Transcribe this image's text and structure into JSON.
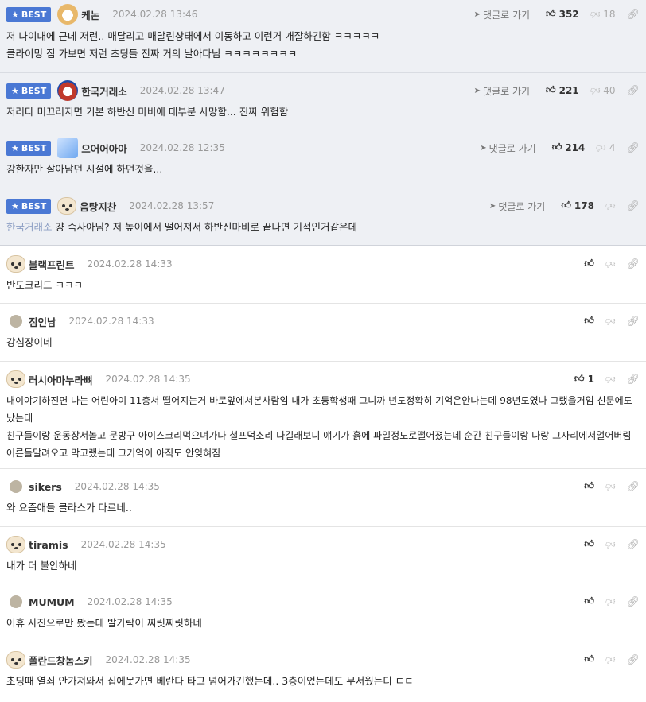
{
  "labels": {
    "best": "BEST",
    "goto": "댓글로 가기"
  },
  "comments": [
    {
      "nick": "케논",
      "date": "2024.02.28 13:46",
      "up": "352",
      "down": "18",
      "lines": [
        "저 나이대에 근데 저런.. 매달리고 매달린상태에서 이동하고 이런거 개잘하긴함 ㅋㅋㅋㅋㅋ",
        "클라이밍 짐 가보면 저런 초딩들 진짜 거의 날아다님 ㅋㅋㅋㅋㅋㅋㅋㅋ"
      ]
    },
    {
      "nick": "한국거래소",
      "date": "2024.02.28 13:47",
      "up": "221",
      "down": "40",
      "lines": [
        "저러다 미끄러지면 기본 하반신 마비에 대부분 사망함... 진짜 위험함"
      ]
    },
    {
      "nick": "으어어아아",
      "date": "2024.02.28 12:35",
      "up": "214",
      "down": "4",
      "lines": [
        "강한자만 살아남던 시절에 하던것을..."
      ]
    },
    {
      "nick": "음탕지찬",
      "date": "2024.02.28 13:57",
      "up": "178",
      "quote": "한국거래소",
      "lines": [
        "걍 즉사아님? 저 높이에서 떨어져서 하반신마비로 끝나면 기적인거같은데"
      ]
    },
    {
      "nick": "블랙프린트",
      "date": "2024.02.28 14:33",
      "lines": [
        "반도크리드 ㅋㅋㅋ"
      ]
    },
    {
      "nick": "짐인남",
      "date": "2024.02.28 14:33",
      "lines": [
        "강심장이네"
      ]
    },
    {
      "nick": "러시아마누라뼈",
      "date": "2024.02.28 14:35",
      "up": "1",
      "lines": [
        "내이야기하진면 나는 어린아이 11층서 떨어지는거 바로앞에서본사람임 내가 초등학생때 그니까 년도정확히 기억은안나는데 98년도였나 그랬을거임 신문에도 났는데",
        "친구들이랑 운동장서놀고 문방구 아이스크리먹으며가다 철프덕소리 나길래보니 얘기가 흙에 파일정도로떨어졌는데 순간 친구들이랑 나랑 그자리에서얼어버림 어른들달려오고 막고랬는데 그기억이 아직도 안잊혀짐"
      ]
    },
    {
      "nick": "sikers",
      "date": "2024.02.28 14:35",
      "lines": [
        "와 요즘애들 클라스가 다르네.."
      ]
    },
    {
      "nick": "tiramis",
      "date": "2024.02.28 14:35",
      "lines": [
        "내가 더 불안하네"
      ]
    },
    {
      "nick": "MUMUM",
      "date": "2024.02.28 14:35",
      "lines": [
        "어휴 사진으로만 봤는데 발가락이 찌릿찌릿하네"
      ]
    },
    {
      "nick": "폴란드창놈스키",
      "date": "2024.02.28 14:35",
      "lines": [
        "초딩때 열쇠 안가져와서 집에못가면 베란다 타고 넘어가긴했는데.. 3층이었는데도 무서웠는디 ㄷㄷ"
      ]
    }
  ]
}
